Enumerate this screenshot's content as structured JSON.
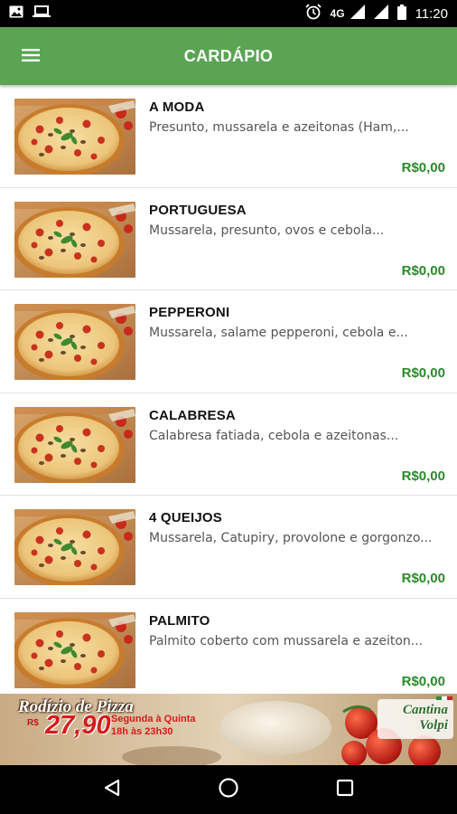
{
  "status_bar": {
    "network": "4G",
    "time": "11:20",
    "icons": [
      "image-icon",
      "laptop-icon",
      "alarm-icon",
      "signal-icon",
      "battery-icon"
    ]
  },
  "app_bar": {
    "title": "CARDÁPIO",
    "menu_icon": "hamburger-menu-icon",
    "background_color": "#5aa454"
  },
  "menu": {
    "items": [
      {
        "name": "A MODA",
        "description": "Presunto, mussarela e azeitonas (Ham,...",
        "price": "R$0,00"
      },
      {
        "name": "PORTUGUESA",
        "description": "Mussarela, presunto, ovos e cebola...",
        "price": "R$0,00"
      },
      {
        "name": "PEPPERONI",
        "description": "Mussarela, salame pepperoni, cebola e...",
        "price": "R$0,00"
      },
      {
        "name": "CALABRESA",
        "description": "Calabresa fatiada, cebola e azeitonas...",
        "price": "R$0,00"
      },
      {
        "name": "4 QUEIJOS",
        "description": "Mussarela, Catupiry, provolone e gorgonzo...",
        "price": "R$0,00"
      },
      {
        "name": "PALMITO",
        "description": "Palmito coberto com mussarela e azeiton...",
        "price": "R$0,00"
      }
    ],
    "price_color": "#2a8a2a"
  },
  "banner": {
    "title": "Rodízio de Pizza",
    "currency": "R$",
    "price": "27,90",
    "days": "Segunda à Quinta",
    "hours": "18h às 23h30",
    "brand_line1": "Cantina",
    "brand_line2": "Volpi"
  },
  "nav_bar": {
    "icons": [
      "back-icon",
      "home-icon",
      "recents-icon"
    ]
  }
}
